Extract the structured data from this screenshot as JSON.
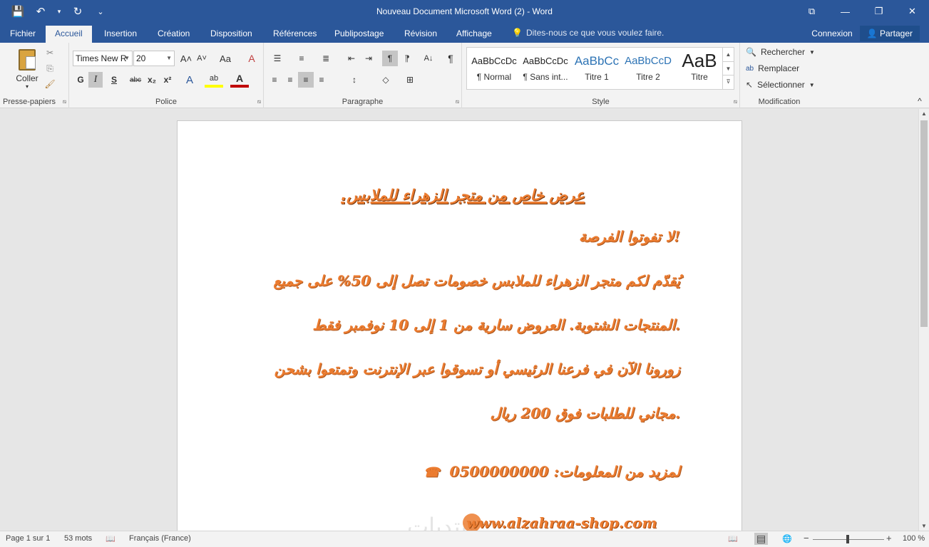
{
  "window": {
    "title": "Nouveau Document Microsoft Word (2) - Word",
    "quick_access": {
      "save": "💾",
      "undo": "↶",
      "undo_dropdown": "▾",
      "repeat": "↻",
      "customize": "⌄"
    },
    "controls": {
      "ribbon_display": "⧉",
      "minimize": "—",
      "maximize": "❐",
      "close": "✕"
    }
  },
  "tabs": [
    {
      "label": "Fichier"
    },
    {
      "label": "Accueil"
    },
    {
      "label": "Insertion"
    },
    {
      "label": "Création"
    },
    {
      "label": "Disposition"
    },
    {
      "label": "Références"
    },
    {
      "label": "Publipostage"
    },
    {
      "label": "Révision"
    },
    {
      "label": "Affichage"
    }
  ],
  "active_tab": "Accueil",
  "tell_me": {
    "icon": "💡",
    "placeholder": "Dites-nous ce que vous voulez faire."
  },
  "account": {
    "signin": "Connexion",
    "share": "Partager",
    "share_icon": "👤"
  },
  "ribbon": {
    "clipboard": {
      "paste_label": "Coller",
      "paste_arrow": "▾",
      "group_label": "Presse-papiers",
      "cut_icon": "✂",
      "copy_icon": "⎘",
      "painter_icon": "🖌",
      "launcher": "⧅"
    },
    "font": {
      "font_name": "Times New R",
      "font_size": "20",
      "grow": "A˄",
      "shrink": "A˅",
      "case": "Aa",
      "clear": "A",
      "bold": "G",
      "italic": "I",
      "underline": "S",
      "strike": "abc",
      "subscript": "x₂",
      "superscript": "x²",
      "effects": "A",
      "highlight": "ab",
      "font_color": "A",
      "group_label": "Police",
      "launcher": "⧅"
    },
    "paragraph": {
      "bullets": "☰",
      "numbering": "≡",
      "multilevel": "≣",
      "decrease_indent": "⇤",
      "increase_indent": "⇥",
      "ltr": "¶",
      "rtl": "¶",
      "sort": "A↓",
      "show_marks": "¶",
      "align_left": "≡",
      "align_center": "≡",
      "align_right": "≡",
      "justify": "≡",
      "line_spacing": "↕",
      "shading": "◇",
      "borders": "⊞",
      "group_label": "Paragraphe",
      "launcher": "⧅"
    },
    "styles": {
      "items": [
        {
          "preview": "AaBbCcDc",
          "name": "¶ Normal"
        },
        {
          "preview": "AaBbCcDc",
          "name": "¶ Sans int..."
        },
        {
          "preview": "AaBbCc",
          "name": "Titre 1"
        },
        {
          "preview": "AaBbCcD",
          "name": "Titre 2"
        },
        {
          "preview": "AaB",
          "name": "Titre"
        }
      ],
      "scroll_up": "▲",
      "scroll_down": "▼",
      "more": "⊽",
      "group_label": "Style",
      "launcher": "⧅"
    },
    "editing": {
      "find": "Rechercher",
      "replace": "Remplacer",
      "select": "Sélectionner",
      "find_icon": "🔍",
      "replace_icon": "ab",
      "select_icon": "↖",
      "group_label": "Modification",
      "collapse": "^"
    }
  },
  "document": {
    "title": "عرض خاص من متجر الزهراء للملابس.",
    "lines": [
      "!لا تفوتوا الفرصة",
      "يُقدّم لكم متجر الزهراء للملابس خصومات تصل إلى 50% على جميع",
      ".المنتجات الشتوية. العروض سارية من 1 إلى 10 نوفمبر فقط",
      "زورونا الآن في فرعنا الرئيسي أو تسوقوا عبر الإنترنت وتمتعوا بشحن",
      ".مجاني للطلبات فوق 200 ريال"
    ],
    "contact": "لمزيد من المعلومات: 0500000000",
    "phone_icon": "☎",
    "url": "www.alzahraa-shop.com",
    "watermark": "منتديات"
  },
  "scrollbar": {
    "up": "▲",
    "down": "▼"
  },
  "status": {
    "page": "Page 1 sur 1",
    "words": "53 mots",
    "proofing_icon": "📖",
    "language": "Français (France)",
    "view_read": "📖",
    "view_print": "▤",
    "view_web": "🌐",
    "zoom_out": "−",
    "zoom_in": "+",
    "zoom": "100 %"
  }
}
